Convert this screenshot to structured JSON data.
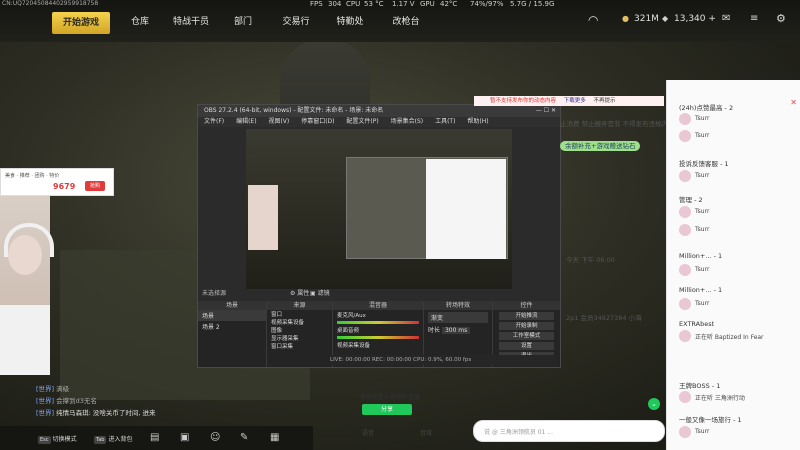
{
  "top": {
    "watermark": "CN:UQ72045084402959918758",
    "fps_label": "FPS",
    "fps": "304",
    "cpu_label": "CPU",
    "cpu_temp": "53 °C",
    "volt": "1.17 V",
    "gpu_label": "GPU",
    "gpu_temp": "42°C",
    "usage": "74%/97%",
    "mem": "5.7G / 15.9G",
    "tabs": [
      "开始游戏",
      "仓库",
      "特战干员",
      "部门",
      "交易行",
      "特勤处",
      "改枪台"
    ],
    "currency1": "321M",
    "currency2": "13,340 +"
  },
  "obs": {
    "title": "OBS 27.2.4 (64-bit, windows) - 配置文件: 未命名 - 场景: 未命名",
    "menu": [
      "文件(F)",
      "编辑(E)",
      "视图(V)",
      "停靠窗口(D)",
      "配置文件(P)",
      "场景集合(S)",
      "工具(T)",
      "帮助(H)"
    ],
    "no_source": "未选择源",
    "props_btn": "属性",
    "filters_btn": "滤镜",
    "docks": [
      "场景",
      "来源",
      "混音器",
      "转场特效",
      "控件"
    ],
    "scenes": [
      "场景",
      "场景 2"
    ],
    "sources": [
      "窗口",
      "视频采集设备",
      "图像",
      "显示器采集",
      "窗口采集"
    ],
    "mixer": [
      "麦克风/Aux",
      "桌面音频",
      "视频采集设备"
    ],
    "transition": "渐变",
    "duration_label": "时长",
    "duration": "300 ms",
    "controls": [
      "开始推流",
      "开始录制",
      "工作室模式",
      "设置",
      "退出"
    ],
    "status": "LIVE: 00:00:00   REC: 00:00:00   CPU: 0.9%, 60.00 fps"
  },
  "chat": {
    "header_notice": "暂不支持发布你的动态内容",
    "notice_btn": "下载更多",
    "notice_close": "不再提示",
    "announce1": "止消费 禁止搬弄是非 不得发布违规内容",
    "announce2": "余额补充+游戏赠送钻石",
    "msg_time": "今天 下午 06:00",
    "msg_text": "2p1 会员34827384 小海",
    "input_placeholder": "说 @ 三角洲领航员 01 ...",
    "bottom_labels": [
      "快来观看斗鱼精彩直播",
      "音效"
    ],
    "share_btn": "分享",
    "voice_btn": "语音"
  },
  "sidebar": {
    "groups": [
      {
        "title": "(24h)点赞最高 - 2",
        "users": [
          "Tsurr",
          "Tsurr"
        ]
      },
      {
        "title": "投诉反馈客服 - 1",
        "users": [
          "Tsurr"
        ]
      },
      {
        "title": "管理 - 2",
        "users": [
          "Tsurr",
          "Tsurr"
        ]
      },
      {
        "title": "Million+... - 1",
        "users": [
          "Tsurr"
        ]
      },
      {
        "title": "Million+... - 1",
        "users": [
          "Tsurr"
        ]
      },
      {
        "title": "EXTRAbest",
        "users": [
          "正在听 Baptized In Fear"
        ]
      },
      {
        "title": "王牌BOSS - 1",
        "users": [
          "正在听 三角洲行动"
        ]
      },
      {
        "title": "一般又像一场旅行 - 1",
        "users": [
          "Tsurr"
        ]
      }
    ]
  },
  "overlay": {
    "popup_price": "9679",
    "popup_btn": "抢购",
    "sys_msgs": [
      {
        "tag": "[世界]",
        "text": "满级"
      },
      {
        "tag": "[世界]",
        "text": "会撑到d3无名"
      },
      {
        "tag": "[世界]",
        "text": "纯情马森琪: 没啥关币了时间, 进来"
      }
    ],
    "bottom": [
      {
        "key": "Esc",
        "label": "切换模式"
      },
      {
        "key": "Tab",
        "label": "进入背包"
      }
    ]
  },
  "colors": {
    "accent_green": "#20c75a",
    "tab_yellow": "#e8c33b"
  }
}
